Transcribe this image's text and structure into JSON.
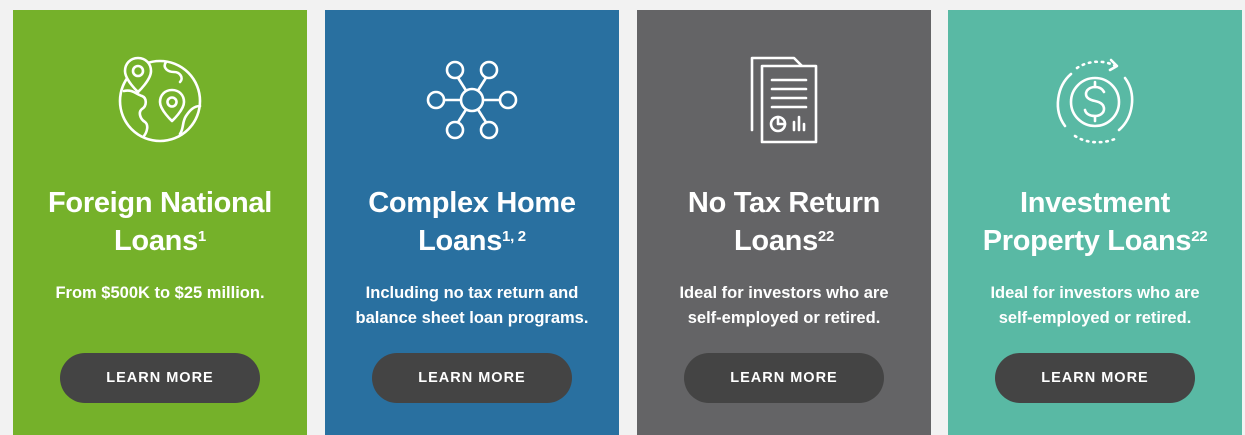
{
  "cards": [
    {
      "id": "foreign-national",
      "bg_color": "#75b12a",
      "icon": "globe-location-pins-icon",
      "title_line1": "Foreign National",
      "title_line2": "Loans",
      "title_sup": "1",
      "desc_line1": "From $500K to $25 million.",
      "desc_line2": "",
      "button_label": "LEARN MORE"
    },
    {
      "id": "complex-home",
      "bg_color": "#2970a0",
      "icon": "network-nodes-icon",
      "title_line1": "Complex Home",
      "title_line2": "Loans",
      "title_sup": "1, 2",
      "desc_line1": "Including no tax return and",
      "desc_line2": "balance sheet loan programs.",
      "button_label": "LEARN MORE"
    },
    {
      "id": "no-tax-return",
      "bg_color": "#646466",
      "icon": "documents-report-icon",
      "title_line1": "No Tax Return",
      "title_line2": "Loans",
      "title_sup": "22",
      "desc_line1": "Ideal for investors who are",
      "desc_line2": "self-employed or retired.",
      "button_label": "LEARN MORE"
    },
    {
      "id": "investment-property",
      "bg_color": "#59b9a4",
      "icon": "dollar-cycle-icon",
      "title_line1": "Investment",
      "title_line2": "Property Loans",
      "title_sup": "22",
      "desc_line1": "Ideal for investors who are",
      "desc_line2": "self-employed or retired.",
      "button_label": "LEARN MORE"
    }
  ],
  "colors": {
    "button_bg": "#444444",
    "text": "#ffffff"
  }
}
